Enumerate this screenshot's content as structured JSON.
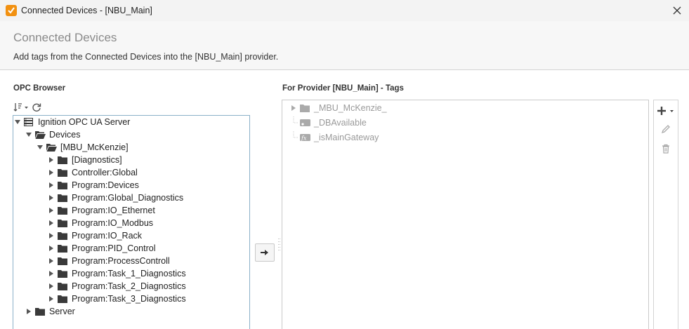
{
  "window": {
    "title": "Connected Devices - [NBU_Main]"
  },
  "header": {
    "title": "Connected Devices",
    "description": "Add tags from the Connected Devices into the [NBU_Main] provider."
  },
  "opc_browser": {
    "label": "OPC Browser",
    "tree": [
      {
        "label": "Ignition OPC UA Server",
        "icon": "server-icon",
        "level": 0,
        "expanded": true
      },
      {
        "label": "Devices",
        "icon": "folder-open-icon",
        "level": 1,
        "expanded": true
      },
      {
        "label": "[MBU_McKenzie]",
        "icon": "folder-open-icon",
        "level": 2,
        "expanded": true
      },
      {
        "label": "[Diagnostics]",
        "icon": "folder-icon",
        "level": 3,
        "expanded": false
      },
      {
        "label": "Controller:Global",
        "icon": "folder-icon",
        "level": 3,
        "expanded": false
      },
      {
        "label": "Program:Devices",
        "icon": "folder-icon",
        "level": 3,
        "expanded": false
      },
      {
        "label": "Program:Global_Diagnostics",
        "icon": "folder-icon",
        "level": 3,
        "expanded": false
      },
      {
        "label": "Program:IO_Ethernet",
        "icon": "folder-icon",
        "level": 3,
        "expanded": false
      },
      {
        "label": "Program:IO_Modbus",
        "icon": "folder-icon",
        "level": 3,
        "expanded": false
      },
      {
        "label": "Program:IO_Rack",
        "icon": "folder-icon",
        "level": 3,
        "expanded": false
      },
      {
        "label": "Program:PID_Control",
        "icon": "folder-icon",
        "level": 3,
        "expanded": false
      },
      {
        "label": "Program:ProcessControll",
        "icon": "folder-icon",
        "level": 3,
        "expanded": false
      },
      {
        "label": "Program:Task_1_Diagnostics",
        "icon": "folder-icon",
        "level": 3,
        "expanded": false
      },
      {
        "label": "Program:Task_2_Diagnostics",
        "icon": "folder-icon",
        "level": 3,
        "expanded": false
      },
      {
        "label": "Program:Task_3_Diagnostics",
        "icon": "folder-icon",
        "level": 3,
        "expanded": false
      },
      {
        "label": "Server",
        "icon": "folder-icon",
        "level": 1,
        "expanded": false
      }
    ]
  },
  "provider_tags": {
    "label": "For Provider [NBU_Main] - Tags",
    "tree": [
      {
        "label": "_MBU_McKenzie_",
        "icon": "folder-icon",
        "expandable": true
      },
      {
        "label": "_DBAvailable",
        "icon": "tag-icon",
        "expandable": false
      },
      {
        "label": "_isMainGateway",
        "icon": "expression-tag-icon",
        "expandable": false
      }
    ]
  },
  "icons": {
    "app": "ignition-app-icon",
    "close": "close-icon",
    "sort": "sort-icon",
    "refresh": "refresh-icon",
    "transfer": "arrow-right-icon",
    "add": "add-icon",
    "edit": "edit-icon",
    "delete": "delete-icon"
  },
  "colors": {
    "accent": "#f29111",
    "tree_border": "#8ab0c8",
    "header_title": "#8a8a8a",
    "disabled_text": "#9a9a9a"
  }
}
